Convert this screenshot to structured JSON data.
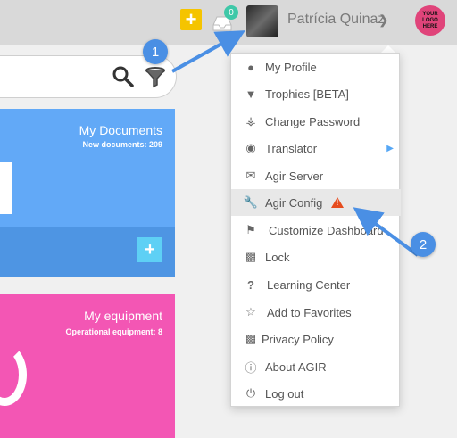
{
  "header": {
    "notification_count": "0",
    "user_name": "Patrícia Quinaz",
    "logo_text": "YOUR LOGO HERE"
  },
  "cards": {
    "documents": {
      "title": "My Documents",
      "subtitle": "New documents: 209"
    },
    "equipment": {
      "title": "My equipment",
      "subtitle": "Operational equipment: 8"
    }
  },
  "menu": {
    "items": [
      {
        "label": "My Profile",
        "icon": "user-icon"
      },
      {
        "label": "Trophies [BETA]",
        "icon": "trophy-icon"
      },
      {
        "label": "Change Password",
        "icon": "key-icon"
      },
      {
        "label": "Translator",
        "icon": "globe-icon"
      },
      {
        "label": "Agir Server",
        "icon": "envelope-icon"
      },
      {
        "label": "Agir Config",
        "icon": "wrench-icon"
      },
      {
        "label": "Customize Dashboard",
        "icon": "flag-icon"
      },
      {
        "label": "Lock",
        "icon": "lock-icon"
      },
      {
        "label": "Learning Center",
        "icon": "question-icon"
      },
      {
        "label": "Add to Favorites",
        "icon": "star-icon"
      },
      {
        "label": "Privacy Policy",
        "icon": "lock-icon"
      },
      {
        "label": "About AGIR",
        "icon": "info-icon"
      },
      {
        "label": "Log out",
        "icon": "power-icon"
      }
    ]
  },
  "annotations": {
    "step1": "1",
    "step2": "2"
  },
  "colors": {
    "accent": "#4a8fe4",
    "warning": "#e64c1e",
    "documents_card": "#62a9f7",
    "equipment_card": "#f356b4"
  }
}
